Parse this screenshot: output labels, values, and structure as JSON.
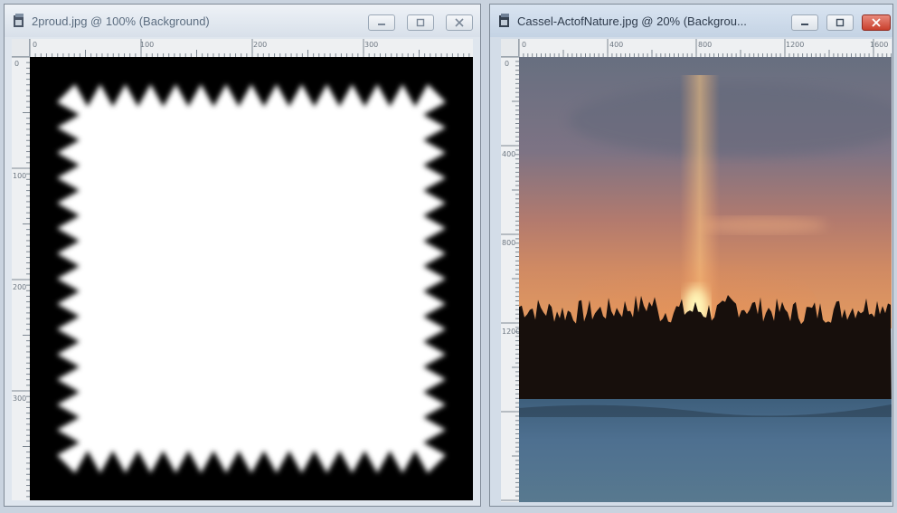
{
  "windows": [
    {
      "title": "2proud.jpg @ 100% (Background)",
      "ruler_top_labels": [
        "0",
        "100",
        "200",
        "300"
      ],
      "ruler_left_labels": [
        "0",
        "100",
        "200",
        "300"
      ]
    },
    {
      "title": "Cassel-ActofNature.jpg @  20% (Backgrou...",
      "ruler_top_labels": [
        "0",
        "400",
        "800",
        "1200",
        "1600"
      ],
      "ruler_left_labels": [
        "0",
        "400",
        "800",
        "1200"
      ]
    }
  ],
  "icons": {
    "document": "document-icon",
    "minimize": "minimize-icon",
    "maximize": "maximize-icon",
    "close": "close-icon"
  },
  "colors": {
    "close_active": "#c9402d",
    "mask_black": "#000000",
    "mask_white": "#ffffff",
    "sky_top": "#6b7384",
    "sky_glow": "#f0a060",
    "snow": "#4f7290"
  }
}
